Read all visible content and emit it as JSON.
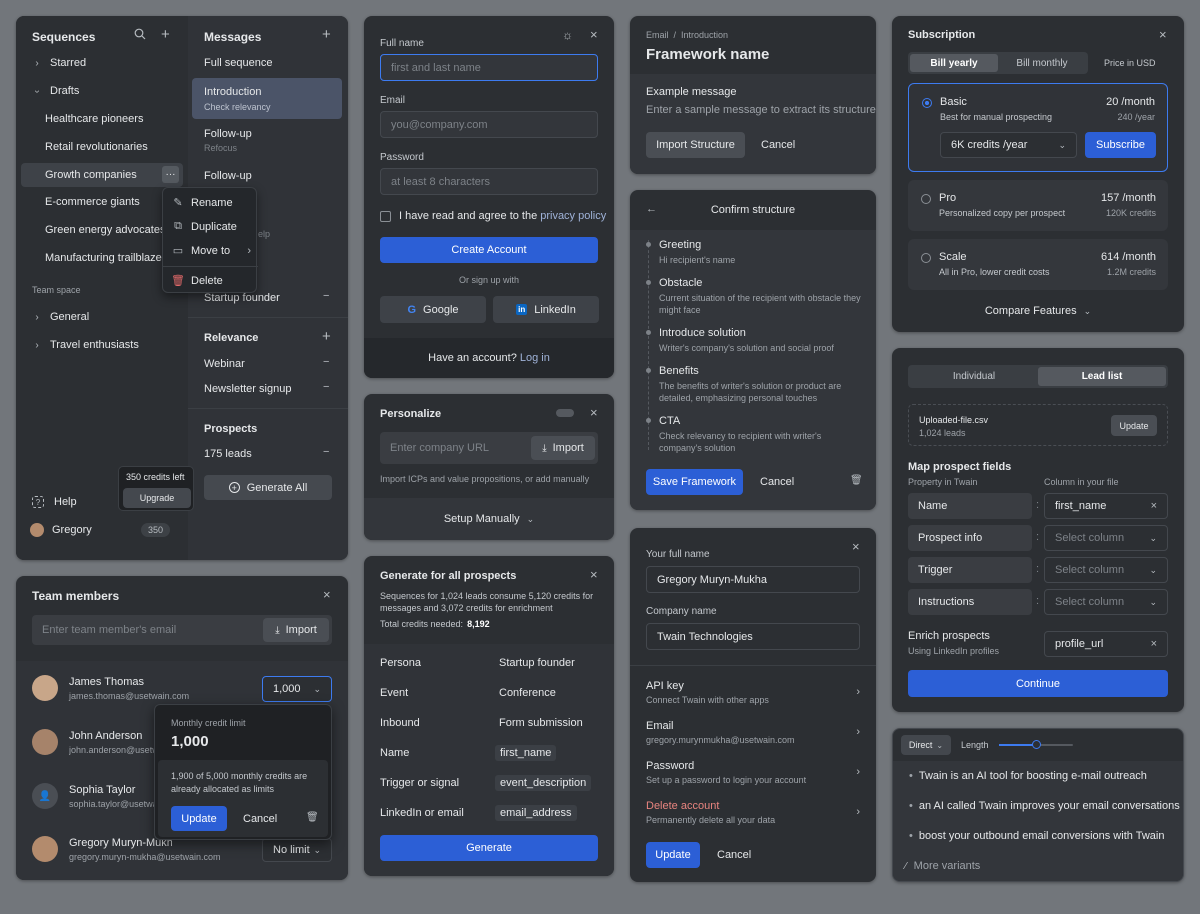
{
  "sequences": {
    "title": "Sequences",
    "starred": "Starred",
    "drafts": "Drafts",
    "items": [
      "Healthcare pioneers",
      "Retail revolutionaries",
      "Growth companies",
      "E-commerce giants",
      "Green energy advocates",
      "Manufacturing trailblazers"
    ],
    "team_space": "Team space",
    "general": "General",
    "travel": "Travel enthusiasts",
    "help": "Help",
    "user": "Gregory",
    "user_credits": "350",
    "credits_left": "350 credits left",
    "upgrade": "Upgrade",
    "menu": [
      "Rename",
      "Duplicate",
      "Move to",
      "Delete"
    ]
  },
  "messages": {
    "title": "Messages",
    "full_sequence": "Full sequence",
    "intro": "Introduction",
    "intro_sub": "Check relevancy",
    "followup1": "Follow-up",
    "followup1_sub": "Refocus",
    "followup2": "Follow-up",
    "partial": "elp",
    "startup": "Startup founder",
    "relevance": "Relevance",
    "webinar": "Webinar",
    "newsletter": "Newsletter signup",
    "prospects": "Prospects",
    "leads": "175 leads",
    "generate_all": "Generate All"
  },
  "team": {
    "title": "Team members",
    "email_placeholder": "Enter team member's email",
    "import": "Import",
    "members": [
      {
        "name": "James Thomas",
        "email": "james.thomas@usetwain.com"
      },
      {
        "name": "John Anderson",
        "email": "john.anderson@usetwain.com"
      },
      {
        "name": "Sophia Taylor",
        "email": "sophia.taylor@usetwain.com"
      },
      {
        "name": "Gregory Muryn-Mukha",
        "email": "gregory.muryn-mukha@usetwain.com"
      }
    ],
    "limit_value": "1,000",
    "no_limit": "No limit",
    "popup_label": "Monthly credit limit",
    "popup_value": "1,000",
    "popup_note": "1,900 of 5,000 monthly credits are already allocated as limits",
    "update": "Update",
    "cancel": "Cancel"
  },
  "signup": {
    "full_name_label": "Full name",
    "full_name_ph": "first and last name",
    "email_label": "Email",
    "email_ph": "you@company.com",
    "password_label": "Password",
    "password_ph": "at least 8 characters",
    "agree": "I have read and agree to the",
    "privacy": "privacy policy",
    "create": "Create Account",
    "or": "Or sign up with",
    "google": "Google",
    "linkedin": "LinkedIn",
    "have_account": "Have an account?",
    "login": "Log in"
  },
  "personalize": {
    "title": "Personalize",
    "url_ph": "Enter company URL",
    "import": "Import",
    "note": "Import ICPs and value propositions, or add manually",
    "setup": "Setup Manually"
  },
  "generate": {
    "title": "Generate for all prospects",
    "desc": "Sequences for 1,024 leads consume 5,120 credits for messages and 3,072 credits for enrichment",
    "total_label": "Total credits needed:",
    "total": "8,192",
    "rows": [
      {
        "k": "Persona",
        "v": "Startup founder",
        "chip": false
      },
      {
        "k": "Event",
        "v": "Conference",
        "chip": false
      },
      {
        "k": "Inbound",
        "v": "Form submission",
        "chip": false
      },
      {
        "k": "Name",
        "v": "first_name",
        "chip": true
      },
      {
        "k": "Trigger or signal",
        "v": "event_description",
        "chip": true
      },
      {
        "k": "LinkedIn or email",
        "v": "email_address",
        "chip": true
      }
    ],
    "button": "Generate"
  },
  "framework": {
    "crumb1": "Email",
    "crumb_sep": "/",
    "crumb2": "Introduction",
    "title": "Framework name",
    "example_label": "Example message",
    "example_ph": "Enter a sample message to extract its structure",
    "import": "Import Structure",
    "cancel": "Cancel"
  },
  "confirm": {
    "title": "Confirm structure",
    "items": [
      {
        "h": "Greeting",
        "d": "Hi recipient's name"
      },
      {
        "h": "Obstacle",
        "d": "Current situation of the recipient with obstacle they might face"
      },
      {
        "h": "Introduce solution",
        "d": "Writer's company's solution and social proof"
      },
      {
        "h": "Benefits",
        "d": "The benefits of writer's solution or product are detailed, emphasizing personal touches"
      },
      {
        "h": "CTA",
        "d": "Check relevancy to recipient with writer's company's solution"
      }
    ],
    "save": "Save Framework",
    "cancel": "Cancel"
  },
  "profile": {
    "name_label": "Your full name",
    "name_value": "Gregory Muryn-Mukha",
    "company_label": "Company name",
    "company_value": "Twain Technologies",
    "rows": [
      {
        "h": "API key",
        "d": "Connect Twain with other apps"
      },
      {
        "h": "Email",
        "d": "gregory.murynmukha@usetwain.com"
      },
      {
        "h": "Password",
        "d": "Set up a password to login your account"
      },
      {
        "h": "Delete account",
        "d": "Permanently delete all your data"
      }
    ],
    "update": "Update",
    "cancel": "Cancel"
  },
  "subscription": {
    "title": "Subscription",
    "yearly": "Bill yearly",
    "monthly": "Bill monthly",
    "currency": "Price in USD",
    "plans": [
      {
        "name": "Basic",
        "desc": "Best for manual prospecting",
        "price": "20 /month",
        "sub": "240 /year"
      },
      {
        "name": "Pro",
        "desc": "Personalized copy per prospect",
        "price": "157 /month",
        "sub": "120K credits"
      },
      {
        "name": "Scale",
        "desc": "All in Pro, lower credit costs",
        "price": "614 /month",
        "sub": "1.2M credits"
      }
    ],
    "credits_select": "6K credits /year",
    "subscribe": "Subscribe",
    "compare": "Compare Features"
  },
  "leads": {
    "tab1": "Individual",
    "tab2": "Lead list",
    "file": "Uploaded-file.csv",
    "file_sub": "1,024 leads",
    "update": "Update",
    "map_title": "Map prospect fields",
    "col1": "Property in Twain",
    "col2": "Column in your file",
    "fields": [
      {
        "k": "Name",
        "v": "first_name",
        "set": true
      },
      {
        "k": "Prospect info",
        "v": "Select column",
        "set": false
      },
      {
        "k": "Trigger",
        "v": "Select column",
        "set": false
      },
      {
        "k": "Instructions",
        "v": "Select column",
        "set": false
      }
    ],
    "enrich": "Enrich prospects",
    "enrich_sub": "Using LinkedIn profiles",
    "enrich_value": "profile_url",
    "continue": "Continue"
  },
  "variants": {
    "mode": "Direct",
    "length": "Length",
    "length_level": 0.5,
    "items": [
      "Twain is an AI tool for boosting e-mail outreach",
      "an AI called Twain improves your email conversations",
      "boost your outbound email conversions with Twain"
    ],
    "more": "More variants"
  },
  "colors": {
    "accent": "#2c5fd6",
    "bg": "#72767b",
    "card": "#2c2f33"
  }
}
